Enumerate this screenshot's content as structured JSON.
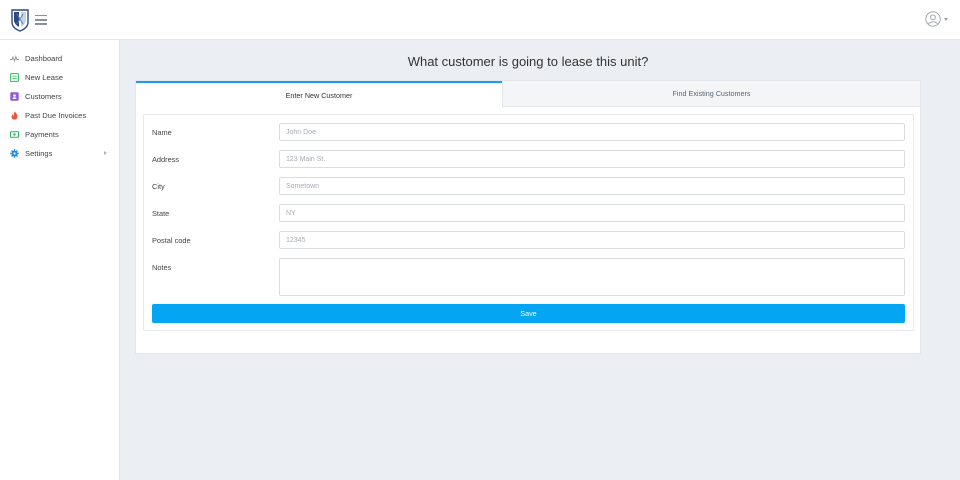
{
  "header": {
    "logo_icon": "shield-logo-icon",
    "menu_icon": "hamburger-menu-icon",
    "user_icon": "user-avatar-icon"
  },
  "sidebar": {
    "items": [
      {
        "label": "Dashboard",
        "icon": "activity-icon",
        "color": "#8a9099"
      },
      {
        "label": "New Lease",
        "icon": "clipboard-icon",
        "color": "#34b55b"
      },
      {
        "label": "Customers",
        "icon": "contact-card-icon",
        "color": "#8e5ad9"
      },
      {
        "label": "Past Due Invoices",
        "icon": "fire-icon",
        "color": "#e8553a"
      },
      {
        "label": "Payments",
        "icon": "money-icon",
        "color": "#2fb25d"
      },
      {
        "label": "Settings",
        "icon": "gear-icon",
        "color": "#1c8ad8",
        "has_submenu": true
      }
    ]
  },
  "main": {
    "title": "What customer is going to lease this unit?",
    "tabs": [
      {
        "label": "Enter New Customer",
        "active": true
      },
      {
        "label": "Find Existing Customers",
        "active": false
      }
    ],
    "form": {
      "name": {
        "label": "Name",
        "placeholder": "John Doe",
        "value": ""
      },
      "address": {
        "label": "Address",
        "placeholder": "123 Main St.",
        "value": ""
      },
      "city": {
        "label": "City",
        "placeholder": "Sometown",
        "value": ""
      },
      "state": {
        "label": "State",
        "placeholder": "NY",
        "value": ""
      },
      "postal_code": {
        "label": "Postal code",
        "placeholder": "12345",
        "value": ""
      },
      "notes": {
        "label": "Notes",
        "placeholder": "",
        "value": ""
      },
      "save_label": "Save"
    }
  },
  "colors": {
    "accent": "#04a5f3",
    "tab_active_border": "#1a9cf0",
    "page_background": "#ebeef2"
  }
}
